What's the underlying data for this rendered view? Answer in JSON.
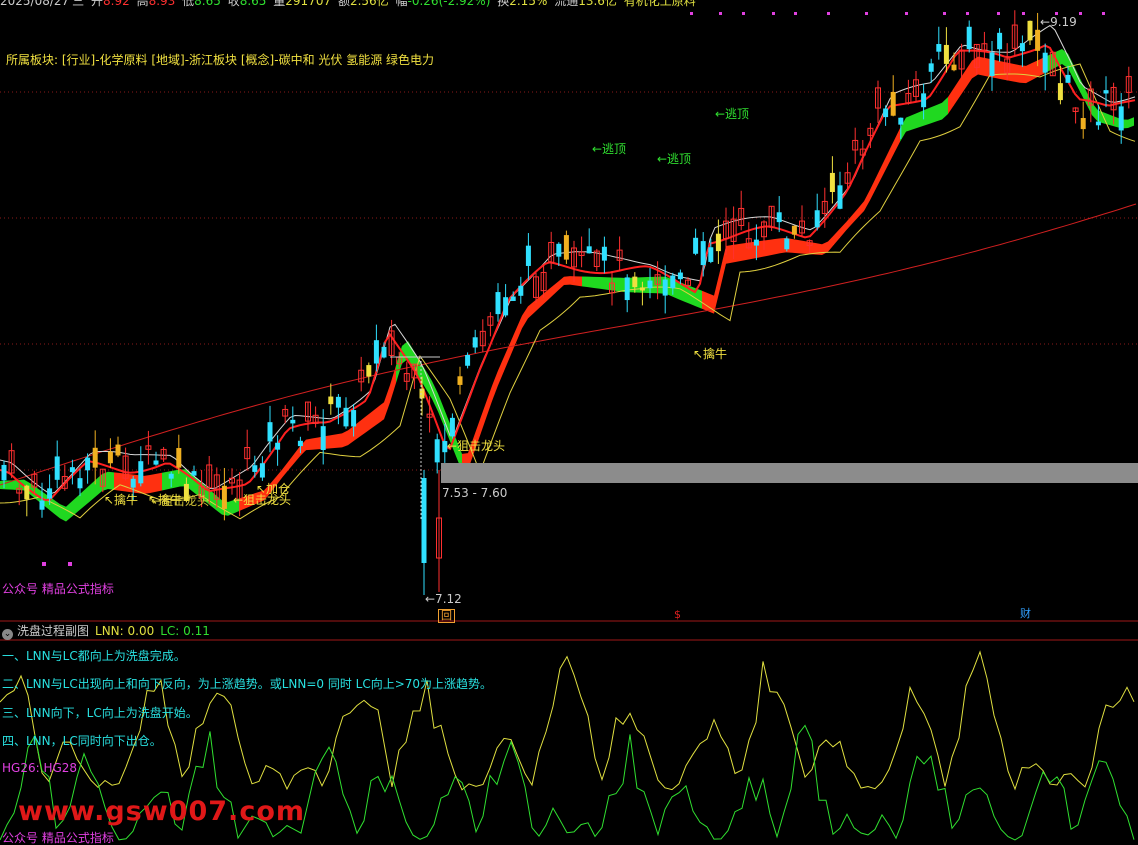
{
  "quote": {
    "date": "2025/08/27",
    "weekday": "三",
    "open_label": "开",
    "open": "8.92",
    "high_label": "高",
    "high": "8.93",
    "low_label": "低",
    "low": "8.65",
    "close_label": "收",
    "close": "8.65",
    "volume_label": "量",
    "volume": "291707",
    "amount_label": "额",
    "amount": "2.56亿",
    "change_label": "幅",
    "change": "-0.26(-2.92%)",
    "turnover_label": "换",
    "turnover": "2.15%",
    "float_label": "流通",
    "float": "13.6亿",
    "industry": "有机化工原料"
  },
  "sector_info": "所属板块: [行业]-化学原料 [地域]-浙江板块 [概念]-碳中和 光伏 氢能源 绿色电力",
  "main_signals": [
    {
      "text": "←逃顶",
      "color": "#30e030"
    },
    {
      "text": "←逃顶",
      "color": "#30e030"
    },
    {
      "text": "←逃顶",
      "color": "#30e030"
    },
    {
      "text": "↖擒牛",
      "color": "#f0e040"
    },
    {
      "text": "↖擒牛",
      "color": "#f0e040"
    },
    {
      "text": "↖擒牛",
      "color": "#f0e040"
    },
    {
      "text": "←狙击龙头",
      "color": "#f0e040"
    },
    {
      "text": "←狙击龙头",
      "color": "#f0e040"
    },
    {
      "text": "←狙击龙头",
      "color": "#f0e040"
    },
    {
      "text": "↖加仓",
      "color": "#f0e040"
    }
  ],
  "price_marks": {
    "high_label": "9.19",
    "low_label": "←7.12",
    "zone_label": "7.53 - 7.60"
  },
  "main_footer": "公众号 精品公式指标",
  "axis_markers": [
    {
      "text": "回",
      "color": "#f0a030"
    },
    {
      "text": "$",
      "color": "#e02020"
    },
    {
      "text": "财",
      "color": "#30a0ff"
    }
  ],
  "sub_panel": {
    "title": "洗盘过程副图",
    "lnn": "LNN: 0.00",
    "lc": "LC: 0.11",
    "rules": [
      "一、LNN与LC都向上为洗盘完成。",
      "二、LNN与LC出现向上和向下反向，为上涨趋势。或LNN=0 同时 LC向上>70为上涨趋势。",
      "三、LNN向下，LC向上为洗盘开始。",
      "四、LNN，LC同时向下出仓。"
    ],
    "hg": "HG26: HG28",
    "footer": "公众号 精品公式指标"
  },
  "watermark": "www.gsw007.com",
  "colors": {
    "up": "#ff3030",
    "down": "#30e0ff",
    "ribbon_red": "#ff3010",
    "ribbon_green": "#20e020",
    "lnn": "#e0e040",
    "lc": "#30e030"
  }
}
